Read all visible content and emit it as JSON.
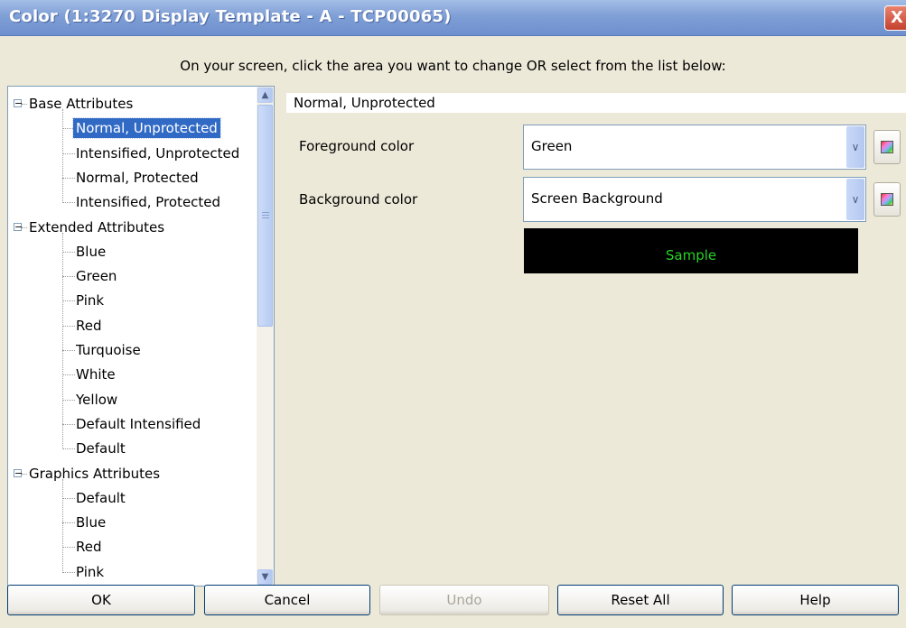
{
  "window": {
    "title": "Color (1:3270 Display Template - A - TCP00065)",
    "close_glyph": "X"
  },
  "instruction": "On your screen, click the area you want to change OR select from the list below:",
  "tree": {
    "groups": [
      {
        "label": "Base Attributes",
        "expander": "−",
        "items": [
          "Normal, Unprotected",
          "Intensified, Unprotected",
          "Normal, Protected",
          "Intensified, Protected"
        ]
      },
      {
        "label": "Extended Attributes",
        "expander": "−",
        "items": [
          "Blue",
          "Green",
          "Pink",
          "Red",
          "Turquoise",
          "White",
          "Yellow",
          "Default Intensified",
          "Default"
        ]
      },
      {
        "label": "Graphics Attributes",
        "expander": "−",
        "items": [
          "Default",
          "Blue",
          "Red",
          "Pink"
        ]
      }
    ],
    "selected": "Normal, Unprotected",
    "scroll_up": "▲",
    "scroll_down": "▼"
  },
  "panel": {
    "heading": "Normal, Unprotected",
    "foreground_label": "Foreground color",
    "foreground_value": "Green",
    "background_label": "Background color",
    "background_value": "Screen Background",
    "dropdown_glyph": "∨",
    "sample_text": "Sample",
    "sample_fg": "#26d126",
    "sample_bg": "#000000"
  },
  "buttons": {
    "ok": "OK",
    "cancel": "Cancel",
    "undo": "Undo",
    "reset_all": "Reset All",
    "help": "Help"
  }
}
